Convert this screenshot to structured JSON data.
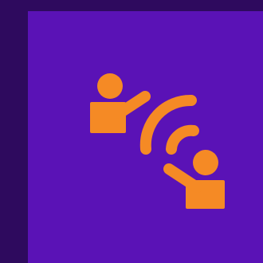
{
  "icon": {
    "name": "remote-interaction-icon",
    "parts": [
      "person-waving-icon",
      "signal-waves-icon",
      "person-waving-icon"
    ]
  },
  "colors": {
    "background": "#2e0a5e",
    "tile": "#5a12b6",
    "icon": "#f58a25"
  }
}
